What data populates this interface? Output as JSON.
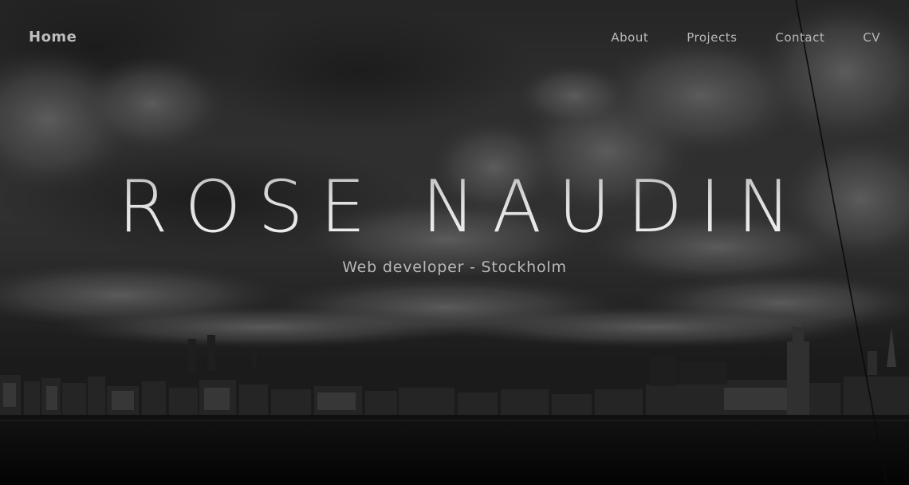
{
  "nav": {
    "home_label": "Home",
    "links": [
      {
        "label": "About"
      },
      {
        "label": "Projects"
      },
      {
        "label": "Contact"
      },
      {
        "label": "CV"
      }
    ]
  },
  "hero": {
    "title": "ROSE NAUDIN",
    "subtitle": "Web developer - Stockholm"
  },
  "colors": {
    "text_primary": "#bdbdbd",
    "title_gradient_top": "#b9b9b9",
    "title_gradient_bottom": "#f2f2f2",
    "background_dark": "#141414"
  }
}
